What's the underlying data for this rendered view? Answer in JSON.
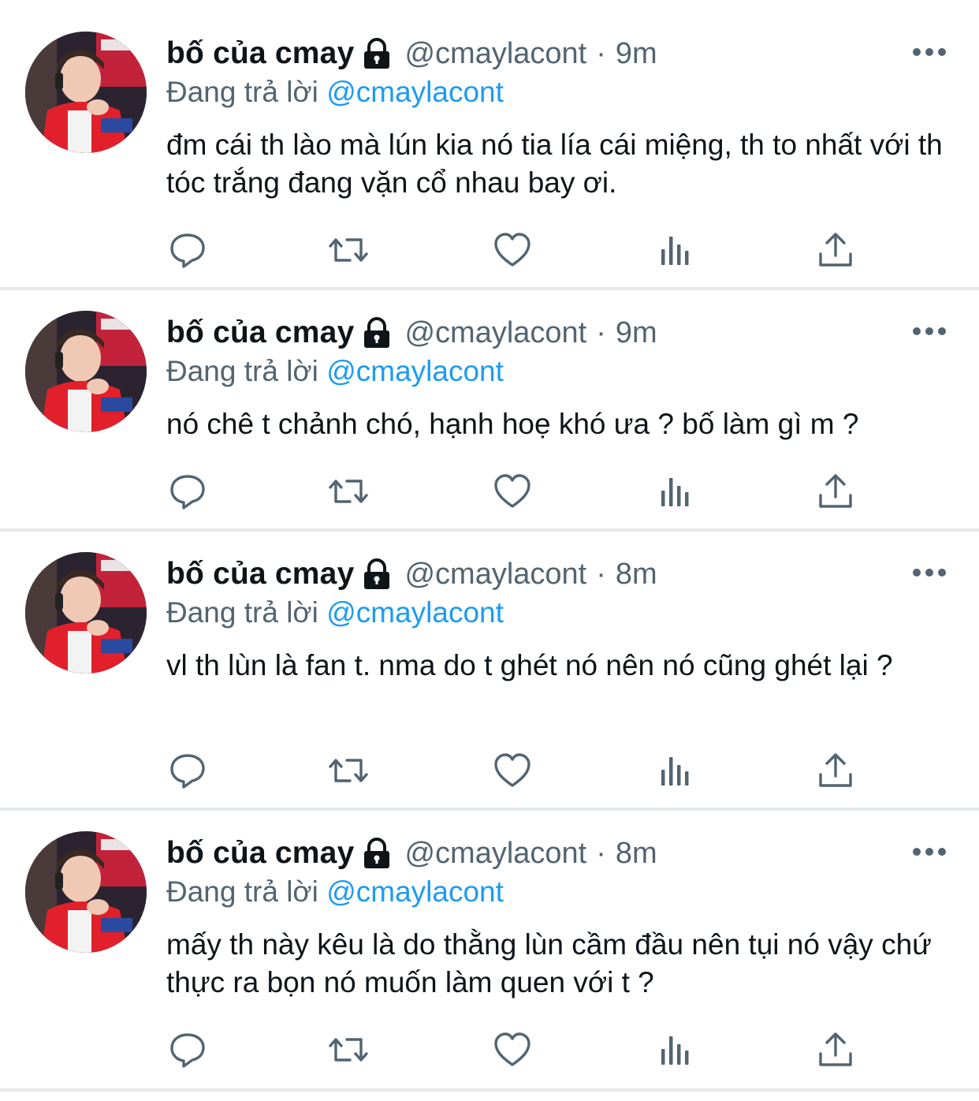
{
  "colors": {
    "text": "#0f1419",
    "secondary": "#536471",
    "link": "#1d9bf0",
    "divider": "#e6e9ec",
    "icon": "#536471"
  },
  "icons": {
    "lock": "lock-icon",
    "more": "more-dots-icon",
    "reply": "reply-bubble-icon",
    "retweet": "retweet-arrows-icon",
    "like": "heart-icon",
    "views": "bar-chart-icon",
    "share": "share-upload-icon"
  },
  "tweets": [
    {
      "display_name": "bố của cmay",
      "handle": "@cmaylacont",
      "separator": "·",
      "time": "9m",
      "reply_prefix": "Đang trả lời",
      "reply_mention": "@cmaylacont",
      "text": "đm cái th lào mà lún kia nó tia lía cái miệng, th to nhất với th tóc trắng đang vặn cổ nhau bay ơi."
    },
    {
      "display_name": "bố của cmay",
      "handle": "@cmaylacont",
      "separator": "·",
      "time": "9m",
      "reply_prefix": "Đang trả lời",
      "reply_mention": "@cmaylacont",
      "text": "nó chê t chảnh chó, hạnh hoẹ khó ưa ? bố làm gì m ?"
    },
    {
      "display_name": "bố của cmay",
      "handle": "@cmaylacont",
      "separator": "·",
      "time": "8m",
      "reply_prefix": "Đang trả lời",
      "reply_mention": "@cmaylacont",
      "text": "vl th lùn là fan t. nma do t ghét nó nên nó cũng ghét lại ?"
    },
    {
      "display_name": "bố của cmay",
      "handle": "@cmaylacont",
      "separator": "·",
      "time": "8m",
      "reply_prefix": "Đang trả lời",
      "reply_mention": "@cmaylacont",
      "text": "mấy th này kêu là do thằng lùn cầm đầu nên tụi nó vậy chứ thực ra bọn nó muốn làm quen với t ?"
    }
  ]
}
